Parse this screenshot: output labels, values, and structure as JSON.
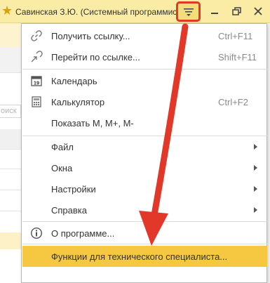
{
  "titlebar": {
    "user": "Савинская З.Ю. (Системный программист)",
    "icons": [
      "star-icon",
      "hamburger-menu-icon",
      "minimize-icon",
      "maximize-icon",
      "close-icon"
    ]
  },
  "background": {
    "search_fragment": "оиск"
  },
  "menu": {
    "get_link": {
      "label": "Получить ссылку...",
      "shortcut": "Ctrl+F11",
      "icon": "link-icon"
    },
    "go_to_link": {
      "label": "Перейти по ссылке...",
      "shortcut": "Shift+F11",
      "icon": "link-arrow-icon"
    },
    "calendar": {
      "label": "Календарь",
      "icon": "calendar-icon",
      "icon_text": "19"
    },
    "calculator": {
      "label": "Калькулятор",
      "shortcut": "Ctrl+F2",
      "icon": "calculator-icon"
    },
    "show_m": {
      "label": "Показать M, M+, M-"
    },
    "file": {
      "label": "Файл"
    },
    "windows": {
      "label": "Окна"
    },
    "settings": {
      "label": "Настройки"
    },
    "help": {
      "label": "Справка"
    },
    "about": {
      "label": "О программе...",
      "icon": "info-icon"
    },
    "tech_functions": {
      "label": "Функции для технического специалиста..."
    }
  },
  "colors": {
    "titlebar_bg": "#fbeca5",
    "highlight": "#f6c842",
    "annotation_red": "#e2382a"
  }
}
